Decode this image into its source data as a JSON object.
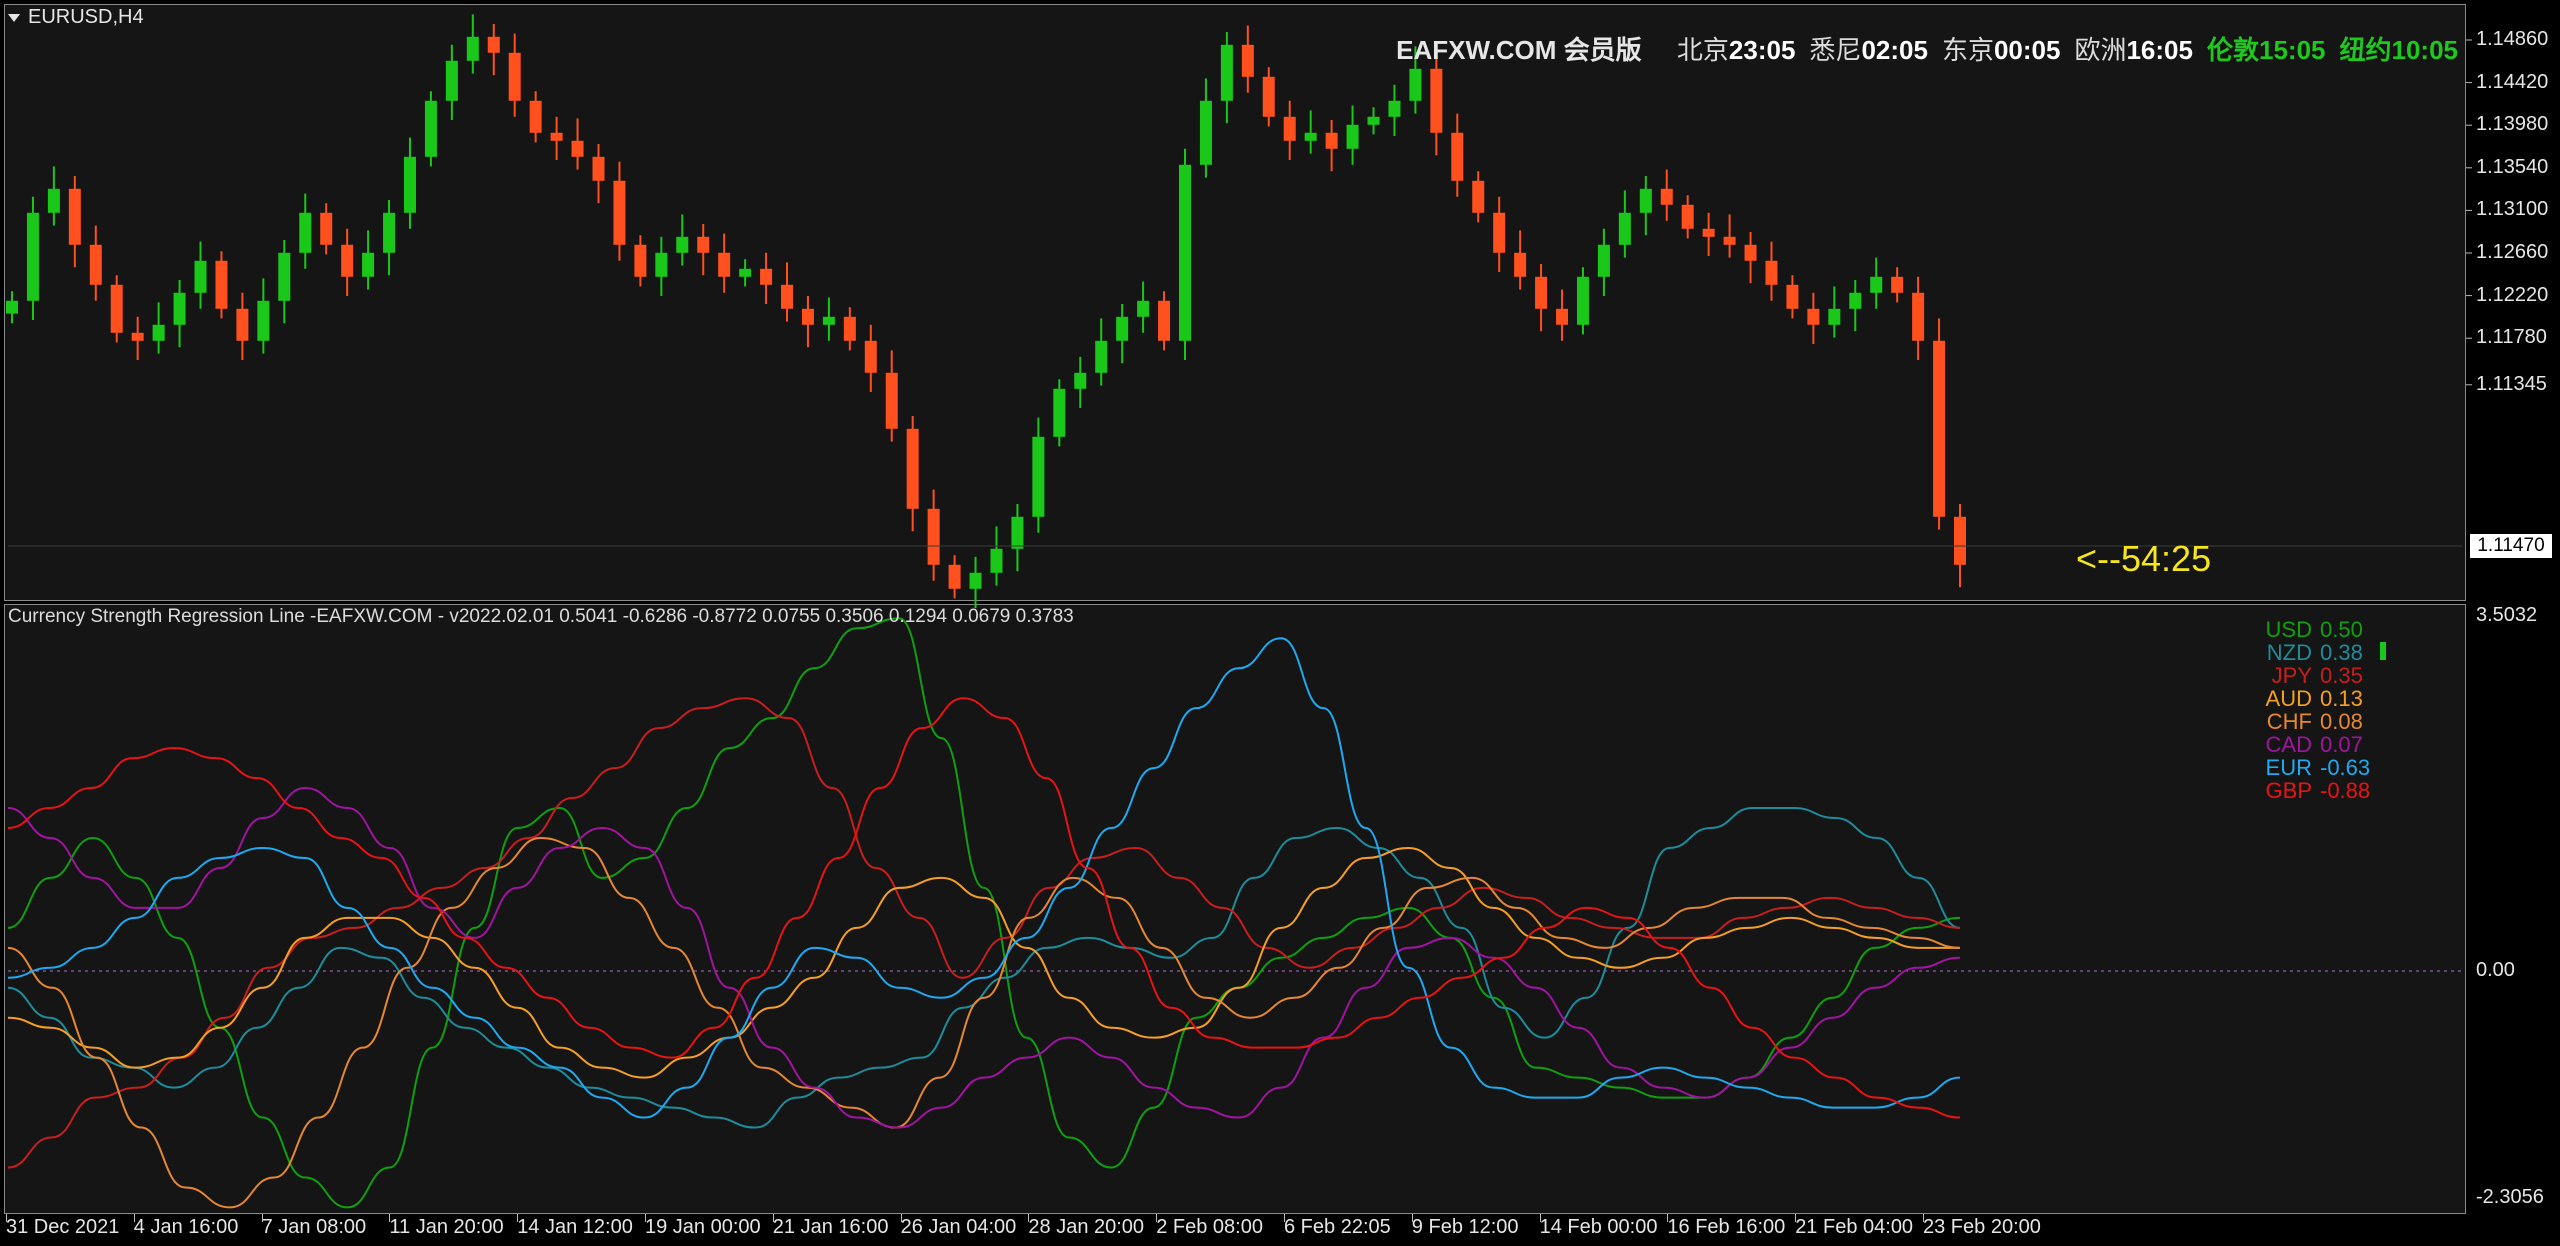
{
  "chart_header": {
    "symbol": "EURUSD,H4"
  },
  "clock": {
    "site": "EAFXW.COM 会员版",
    "zones": [
      {
        "label": "北京",
        "time": "23:05",
        "style": "white"
      },
      {
        "label": "悉尼",
        "time": "02:05",
        "style": "white"
      },
      {
        "label": "东京",
        "time": "00:05",
        "style": "white"
      },
      {
        "label": "欧洲",
        "time": "16:05",
        "style": "white"
      },
      {
        "label": "伦敦",
        "time": "15:05",
        "style": "green"
      },
      {
        "label": "纽约",
        "time": "10:05",
        "style": "green"
      }
    ]
  },
  "countdown": "<--54:25",
  "price_axis": {
    "labels": [
      "1.14860",
      "1.14420",
      "1.13980",
      "1.13540",
      "1.13100",
      "1.12660",
      "1.12220",
      "1.11780",
      "1.11345"
    ],
    "current_price": "1.11470"
  },
  "indicator": {
    "title": "Currency Strength Regression Line -EAFXW.COM - v2022.02.01 0.5041 -0.6286 -0.8772 0.0755 0.3506 0.1294 0.0679 0.3783",
    "axis_labels": {
      "top": "3.5032",
      "zero": "0.00",
      "bottom": "-2.3056"
    },
    "legend": [
      {
        "name": "USD",
        "value": "0.50",
        "color": "#0fa00f"
      },
      {
        "name": "NZD",
        "value": "0.38",
        "color": "#1e8c9b"
      },
      {
        "name": "JPY",
        "value": "0.35",
        "color": "#c81e1e"
      },
      {
        "name": "AUD",
        "value": "0.13",
        "color": "#f5a023"
      },
      {
        "name": "CHF",
        "value": "0.08",
        "color": "#e68732"
      },
      {
        "name": "CAD",
        "value": "0.07",
        "color": "#a014a0"
      },
      {
        "name": "EUR",
        "value": "-0.63",
        "color": "#1eaaf0"
      },
      {
        "name": "GBP",
        "value": "-0.88",
        "color": "#e61414"
      }
    ]
  },
  "time_axis": [
    "31 Dec 2021",
    "4 Jan 16:00",
    "7 Jan 08:00",
    "11 Jan 20:00",
    "14 Jan 12:00",
    "19 Jan 00:00",
    "21 Jan 16:00",
    "26 Jan 04:00",
    "28 Jan 20:00",
    "2 Feb 08:00",
    "6 Feb 22:05",
    "9 Feb 12:00",
    "14 Feb 00:00",
    "16 Feb 16:00",
    "21 Feb 04:00",
    "23 Feb 20:00"
  ],
  "chart_data": [
    {
      "type": "candlestick",
      "title": "EURUSD,H4",
      "ylim": [
        1.1128,
        1.1498
      ],
      "bull_color": "#19c819",
      "bear_color": "#ff501e",
      "closes": [
        1.1315,
        1.137,
        1.1385,
        1.135,
        1.1325,
        1.1295,
        1.129,
        1.13,
        1.132,
        1.134,
        1.131,
        1.129,
        1.1315,
        1.1345,
        1.137,
        1.135,
        1.133,
        1.1345,
        1.137,
        1.1405,
        1.144,
        1.1465,
        1.148,
        1.147,
        1.144,
        1.142,
        1.1415,
        1.1405,
        1.139,
        1.135,
        1.133,
        1.1345,
        1.1355,
        1.1345,
        1.133,
        1.1335,
        1.1325,
        1.131,
        1.13,
        1.1305,
        1.129,
        1.127,
        1.1235,
        1.1185,
        1.115,
        1.1135,
        1.1145,
        1.116,
        1.118,
        1.123,
        1.126,
        1.127,
        1.129,
        1.1305,
        1.1315,
        1.129,
        1.14,
        1.144,
        1.1475,
        1.1455,
        1.143,
        1.1415,
        1.142,
        1.141,
        1.1425,
        1.143,
        1.144,
        1.146,
        1.142,
        1.139,
        1.137,
        1.1345,
        1.133,
        1.131,
        1.13,
        1.133,
        1.135,
        1.137,
        1.1385,
        1.1375,
        1.136,
        1.1355,
        1.135,
        1.134,
        1.1325,
        1.131,
        1.13,
        1.131,
        1.132,
        1.133,
        1.132,
        1.129,
        1.118,
        1.115
      ]
    },
    {
      "type": "line",
      "title": "Currency Strength Regression Line -EAFXW.COM - v2022.02.01 0.5041 -0.6286 -0.8772 0.0755 0.3506 0.1294 0.0679 0.3783",
      "ylim": [
        -2.3056,
        3.5032
      ],
      "series": [
        {
          "name": "USD",
          "values": [
            0.4,
            0.9,
            1.3,
            0.9,
            0.3,
            -0.6,
            -1.5,
            -2.1,
            -2.4,
            -2.0,
            -0.8,
            0.4,
            1.4,
            1.6,
            0.9,
            1.1,
            1.6,
            2.2,
            2.5,
            3.0,
            3.4,
            3.5,
            2.3,
            0.8,
            -0.7,
            -1.7,
            -2.0,
            -1.4,
            -0.5,
            -0.2,
            0.1,
            0.3,
            0.5,
            0.6,
            0.3,
            -0.3,
            -1.0,
            -1.1,
            -1.2,
            -1.3,
            -1.3,
            -1.1,
            -0.7,
            -0.3,
            0.2,
            0.4,
            0.5
          ]
        },
        {
          "name": "NZD",
          "values": [
            -0.2,
            -0.5,
            -0.9,
            -1.0,
            -1.2,
            -1.0,
            -0.6,
            -0.2,
            0.2,
            0.1,
            -0.3,
            -0.6,
            -0.8,
            -1.0,
            -1.2,
            -1.3,
            -1.4,
            -1.5,
            -1.6,
            -1.3,
            -1.1,
            -1.0,
            -0.9,
            -0.4,
            -0.1,
            0.2,
            0.3,
            0.2,
            0.1,
            0.3,
            0.9,
            1.3,
            1.4,
            1.2,
            0.9,
            0.4,
            -0.4,
            -0.7,
            -0.3,
            0.4,
            1.2,
            1.4,
            1.6,
            1.6,
            1.5,
            1.3,
            0.9,
            0.4
          ]
        },
        {
          "name": "JPY",
          "values": [
            -2.0,
            -1.7,
            -1.3,
            -1.2,
            -0.9,
            -0.5,
            0.0,
            0.3,
            0.4,
            0.6,
            0.8,
            1.0,
            1.3,
            1.7,
            2.0,
            2.4,
            2.6,
            2.7,
            2.5,
            1.8,
            1.0,
            0.5,
            -0.1,
            0.3,
            0.8,
            1.1,
            1.2,
            0.9,
            0.6,
            0.2,
            0.0,
            0.2,
            0.4,
            0.6,
            0.8,
            0.7,
            0.5,
            0.4,
            0.3,
            0.3,
            0.5,
            0.6,
            0.7,
            0.6,
            0.5,
            0.4
          ]
        },
        {
          "name": "AUD",
          "values": [
            -0.5,
            -0.6,
            -0.8,
            -1.0,
            -0.9,
            -0.6,
            -0.2,
            0.3,
            0.5,
            0.5,
            0.3,
            0.0,
            -0.4,
            -0.8,
            -1.0,
            -1.1,
            -0.9,
            -0.7,
            -0.4,
            -0.1,
            0.4,
            0.8,
            0.9,
            0.7,
            0.2,
            -0.3,
            -0.6,
            -0.7,
            -0.6,
            -0.2,
            0.4,
            0.8,
            1.1,
            1.2,
            1.0,
            0.6,
            0.3,
            0.1,
            0.0,
            0.1,
            0.3,
            0.4,
            0.5,
            0.4,
            0.3,
            0.2,
            0.2
          ]
        },
        {
          "name": "CHF",
          "values": [
            0.2,
            -0.2,
            -0.9,
            -1.6,
            -2.2,
            -2.4,
            -2.1,
            -1.5,
            -0.8,
            0.0,
            0.6,
            1.0,
            1.3,
            1.2,
            0.7,
            0.2,
            -0.4,
            -1.0,
            -1.2,
            -1.4,
            -1.6,
            -1.1,
            -0.3,
            0.5,
            0.9,
            0.7,
            0.2,
            -0.3,
            -0.5,
            -0.3,
            0.0,
            0.4,
            0.8,
            0.9,
            0.6,
            0.3,
            0.2,
            0.4,
            0.6,
            0.7,
            0.7,
            0.5,
            0.4,
            0.3,
            0.2
          ]
        },
        {
          "name": "CAD",
          "values": [
            1.6,
            1.3,
            0.9,
            0.6,
            0.6,
            1.0,
            1.5,
            1.8,
            1.6,
            1.2,
            0.6,
            0.3,
            0.8,
            1.2,
            1.4,
            1.2,
            0.6,
            -0.2,
            -0.8,
            -1.2,
            -1.5,
            -1.6,
            -1.4,
            -1.1,
            -0.9,
            -0.7,
            -0.9,
            -1.2,
            -1.4,
            -1.5,
            -1.2,
            -0.7,
            -0.2,
            0.2,
            0.3,
            0.1,
            -0.2,
            -0.6,
            -1.0,
            -1.2,
            -1.3,
            -1.1,
            -0.8,
            -0.5,
            -0.2,
            0.0,
            0.1
          ]
        },
        {
          "name": "EUR",
          "values": [
            -0.1,
            0.0,
            0.2,
            0.5,
            0.9,
            1.1,
            1.2,
            1.1,
            0.6,
            0.2,
            -0.2,
            -0.5,
            -0.8,
            -1.0,
            -1.3,
            -1.5,
            -1.2,
            -0.7,
            -0.2,
            0.2,
            0.1,
            -0.2,
            -0.3,
            -0.1,
            0.3,
            0.8,
            1.4,
            2.0,
            2.6,
            3.0,
            3.3,
            2.6,
            1.4,
            0.0,
            -0.8,
            -1.2,
            -1.3,
            -1.3,
            -1.1,
            -1.0,
            -1.1,
            -1.2,
            -1.3,
            -1.4,
            -1.4,
            -1.3,
            -1.1
          ]
        },
        {
          "name": "GBP",
          "values": [
            1.4,
            1.6,
            1.8,
            2.1,
            2.2,
            2.1,
            1.9,
            1.6,
            1.3,
            1.1,
            0.7,
            0.3,
            0.0,
            -0.3,
            -0.6,
            -0.8,
            -0.9,
            -0.6,
            -0.1,
            0.5,
            1.1,
            1.8,
            2.4,
            2.7,
            2.5,
            1.9,
            1.0,
            0.2,
            -0.4,
            -0.7,
            -0.8,
            -0.8,
            -0.7,
            -0.5,
            -0.3,
            -0.1,
            0.1,
            0.4,
            0.6,
            0.5,
            0.2,
            -0.2,
            -0.6,
            -0.9,
            -1.1,
            -1.3,
            -1.4,
            -1.5
          ]
        }
      ]
    }
  ]
}
